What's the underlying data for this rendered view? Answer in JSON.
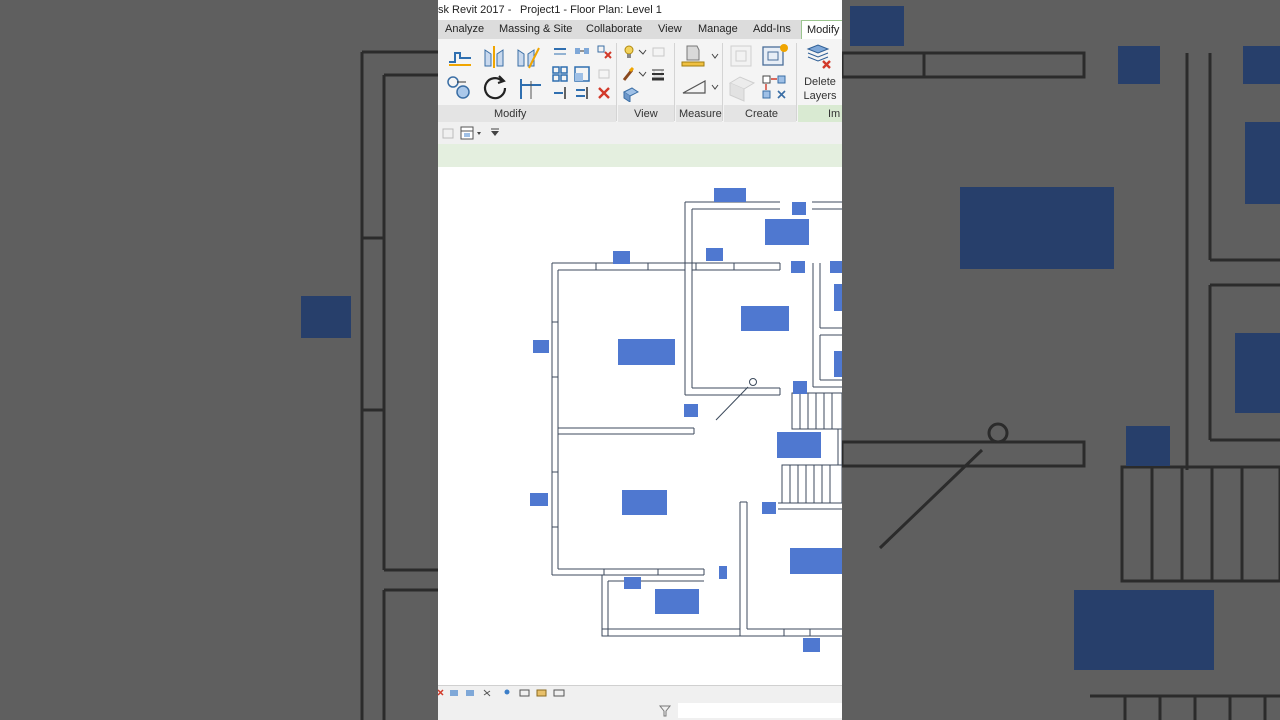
{
  "window": {
    "title_app": "sk Revit 2017 -",
    "title_doc": "Project1 - Floor Plan: Level 1"
  },
  "ribbon": {
    "tabs": [
      {
        "label": "Analyze"
      },
      {
        "label": "Massing & Site"
      },
      {
        "label": "Collaborate"
      },
      {
        "label": "View"
      },
      {
        "label": "Manage"
      },
      {
        "label": "Add-Ins"
      },
      {
        "label": "Modify"
      }
    ],
    "active_tab": "Modify",
    "panels": [
      {
        "label": "Modify"
      },
      {
        "label": "View"
      },
      {
        "label": "Measure"
      },
      {
        "label": "Create"
      },
      {
        "label": "Im"
      }
    ],
    "delete_layers": {
      "line1": "Delete",
      "line2": "Layers"
    }
  },
  "colors": {
    "tag_fill": "#4f78d0",
    "wall_stroke": "#3c4a5c",
    "active_tab_border": "#9bc58f",
    "options_bar": "#e4efdf",
    "background_blur": "#5e5e5e"
  }
}
